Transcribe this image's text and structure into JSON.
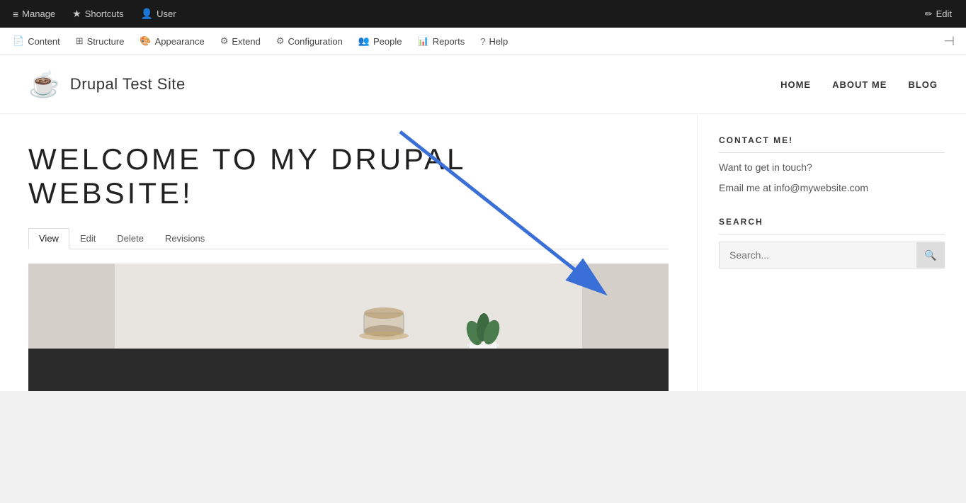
{
  "admin_toolbar": {
    "items": [
      {
        "label": "Manage",
        "icon": "≡"
      },
      {
        "label": "Shortcuts",
        "icon": "★"
      },
      {
        "label": "User",
        "icon": "👤"
      }
    ],
    "edit_label": "Edit",
    "edit_icon": "✏"
  },
  "secondary_nav": {
    "items": [
      {
        "label": "Content",
        "icon": "📄"
      },
      {
        "label": "Structure",
        "icon": "⊞"
      },
      {
        "label": "Appearance",
        "icon": "🎨"
      },
      {
        "label": "Extend",
        "icon": "⚙"
      },
      {
        "label": "Configuration",
        "icon": "⚙"
      },
      {
        "label": "People",
        "icon": "👥"
      },
      {
        "label": "Reports",
        "icon": "📊"
      },
      {
        "label": "Help",
        "icon": "?"
      }
    ]
  },
  "site": {
    "logo_icon": "☕",
    "title": "Drupal Test Site",
    "nav": [
      {
        "label": "HOME"
      },
      {
        "label": "ABOUT ME"
      },
      {
        "label": "BLOG"
      }
    ]
  },
  "main": {
    "heading_line1": "WELCOME TO MY DRUPAL",
    "heading_line2": "WEBSITE!",
    "tabs": [
      {
        "label": "View",
        "active": true
      },
      {
        "label": "Edit"
      },
      {
        "label": "Delete"
      },
      {
        "label": "Revisions"
      }
    ]
  },
  "sidebar": {
    "contact_title": "CONTACT ME!",
    "contact_text1": "Want to get in touch?",
    "contact_text2": "Email me at info@mywebsite.com",
    "search_title": "SEARCH",
    "search_placeholder": "Search..."
  }
}
